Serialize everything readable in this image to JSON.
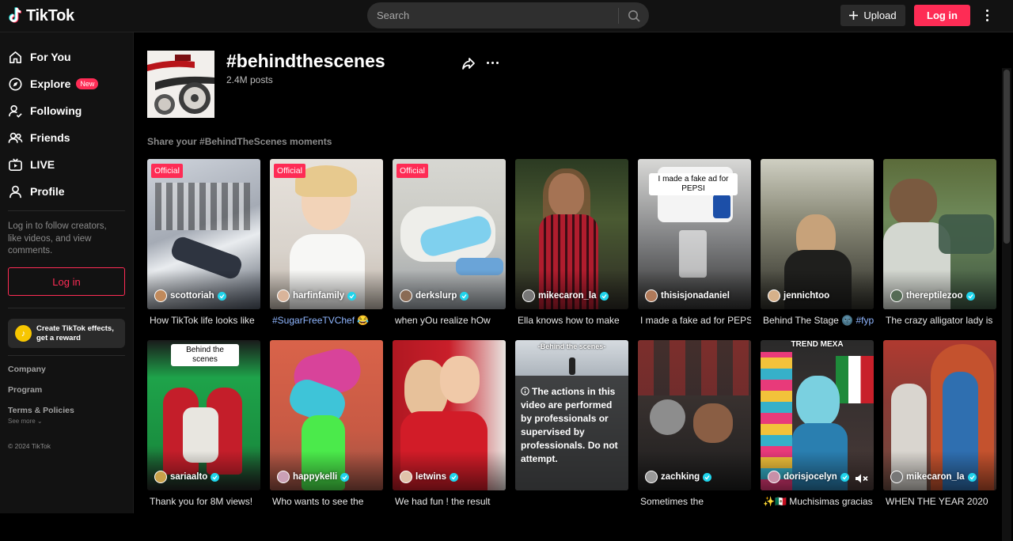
{
  "header": {
    "logo_text": "TikTok",
    "search_placeholder": "Search",
    "upload_label": "Upload",
    "login_label": "Log in"
  },
  "sidebar": {
    "nav": [
      {
        "label": "For You",
        "icon": "home-icon"
      },
      {
        "label": "Explore",
        "icon": "compass-icon",
        "badge": "New"
      },
      {
        "label": "Following",
        "icon": "user-check-icon"
      },
      {
        "label": "Friends",
        "icon": "friends-icon"
      },
      {
        "label": "LIVE",
        "icon": "live-tv-icon"
      },
      {
        "label": "Profile",
        "icon": "person-icon"
      }
    ],
    "login_prompt": "Log in to follow creators, like videos, and view comments.",
    "login_button": "Log in",
    "effects_line1": "Create TikTok effects,",
    "effects_line2": "get a reward",
    "footer": {
      "company": "Company",
      "program": "Program",
      "terms": "Terms & Policies",
      "see_more": "See more",
      "copyright": "© 2024 TikTok"
    }
  },
  "tag": {
    "title": "#behindthescenes",
    "posts": "2.4M posts",
    "description": "Share your #BehindTheScenes moments"
  },
  "videos": [
    {
      "author": "scottoriah",
      "verified": true,
      "caption": "How TikTok life looks like",
      "official": "Official"
    },
    {
      "author": "harfinfamily",
      "verified": true,
      "caption_hashtag": "#SugarFreeTVChef",
      "caption_emoji": "😂",
      "official": "Official"
    },
    {
      "author": "derkslurp",
      "verified": true,
      "caption": "when yOu realize hOw",
      "official": "Official"
    },
    {
      "author": "mikecaron_la",
      "verified": true,
      "caption": "Ella knows how to make"
    },
    {
      "author": "thisisjonadaniel",
      "verified": false,
      "caption": "I made a fake ad for PEPSI",
      "overlay": "I made a fake ad for PEPSI"
    },
    {
      "author": "jennichtoo",
      "verified": false,
      "caption": "Behind The Stage 🌚 ",
      "caption_hashtag": "#fyp"
    },
    {
      "author": "thereptilezoo",
      "verified": true,
      "caption": "The crazy alligator lady is"
    },
    {
      "author": "sariaalto",
      "verified": true,
      "caption": "Thank you for 8M views!",
      "overlay": "Behind the scenes"
    },
    {
      "author": "happykelli",
      "verified": true,
      "caption": "Who wants to see the"
    },
    {
      "author": "letwins",
      "verified": true,
      "caption": "We had fun ! the result"
    },
    {
      "author": "",
      "verified": false,
      "caption": "",
      "overlay": "-Behind the scenes-",
      "warning": "The actions in this video are performed by professionals or supervised by professionals. Do not attempt."
    },
    {
      "author": "zachking",
      "verified": true,
      "caption": "Sometimes the"
    },
    {
      "author": "dorisjocelyn",
      "verified": true,
      "caption": "✨🇲🇽 Muchisimas gracias",
      "overlay": "TREND MEXA"
    },
    {
      "author": "mikecaron_la",
      "verified": true,
      "caption": "WHEN THE YEAR 2020"
    }
  ]
}
